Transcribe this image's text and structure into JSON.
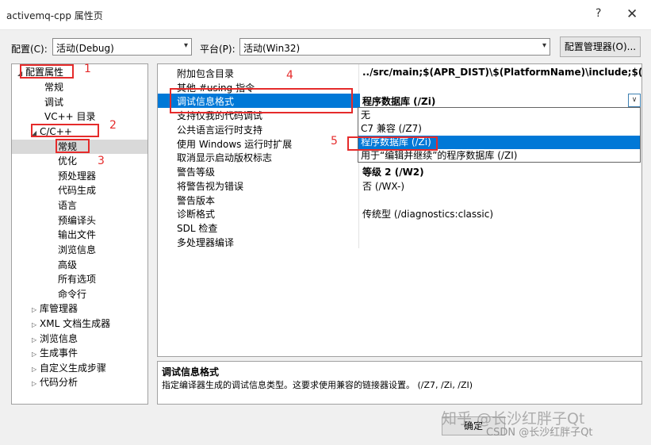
{
  "window": {
    "title": "activemq-cpp 属性页",
    "help_glyph": "?",
    "close_glyph": "✕"
  },
  "config_bar": {
    "config_label": "配置(C):",
    "config_value": "活动(Debug)",
    "platform_label": "平台(P):",
    "platform_value": "活动(Win32)",
    "manager_button": "配置管理器(O)..."
  },
  "tree": {
    "items": [
      {
        "label": "配置属性",
        "expander": "◢"
      },
      {
        "label": "常规",
        "expander": ""
      },
      {
        "label": "调试",
        "expander": ""
      },
      {
        "label": "VC++ 目录",
        "expander": ""
      },
      {
        "label": "C/C++",
        "expander": "◢"
      },
      {
        "label": "常规",
        "expander": ""
      },
      {
        "label": "优化",
        "expander": ""
      },
      {
        "label": "预处理器",
        "expander": ""
      },
      {
        "label": "代码生成",
        "expander": ""
      },
      {
        "label": "语言",
        "expander": ""
      },
      {
        "label": "预编译头",
        "expander": ""
      },
      {
        "label": "输出文件",
        "expander": ""
      },
      {
        "label": "浏览信息",
        "expander": ""
      },
      {
        "label": "高级",
        "expander": ""
      },
      {
        "label": "所有选项",
        "expander": ""
      },
      {
        "label": "命令行",
        "expander": ""
      },
      {
        "label": "库管理器",
        "expander": "▷"
      },
      {
        "label": "XML 文档生成器",
        "expander": "▷"
      },
      {
        "label": "浏览信息",
        "expander": "▷"
      },
      {
        "label": "生成事件",
        "expander": "▷"
      },
      {
        "label": "自定义生成步骤",
        "expander": "▷"
      },
      {
        "label": "代码分析",
        "expander": "▷"
      }
    ]
  },
  "properties": [
    {
      "name": "附加包含目录",
      "value": "../src/main;$(APR_DIST)\\$(PlatformName)\\include;$(OPENSSL"
    },
    {
      "name": "其他 #using 指令",
      "value": ""
    },
    {
      "name": "调试信息格式",
      "value": "程序数据库 (/Zi)"
    },
    {
      "name": "支持仅我的代码调试",
      "value": ""
    },
    {
      "name": "公共语言运行时支持",
      "value": ""
    },
    {
      "name": "使用 Windows 运行时扩展",
      "value": ""
    },
    {
      "name": "取消显示启动版权标志",
      "value": ""
    },
    {
      "name": "警告等级",
      "value": "等级 2 (/W2)"
    },
    {
      "name": "将警告视为错误",
      "value": "否 (/WX-)"
    },
    {
      "name": "警告版本",
      "value": ""
    },
    {
      "name": "诊断格式",
      "value": "传统型 (/diagnostics:classic)"
    },
    {
      "name": "SDL 检查",
      "value": ""
    },
    {
      "name": "多处理器编译",
      "value": ""
    }
  ],
  "dropdown": {
    "options": [
      "无",
      "C7 兼容 (/Z7)",
      "程序数据库 (/Zi)",
      "用于“编辑并继续”的程序数据库 (/ZI)"
    ],
    "selected": "程序数据库 (/Zi)"
  },
  "description": {
    "title": "调试信息格式",
    "text": "指定编译器生成的调试信息类型。这要求使用兼容的链接器设置。  (/Z7, /Zi, /ZI)"
  },
  "buttons": {
    "ok": "确定"
  },
  "annotations": [
    "1",
    "2",
    "3",
    "4",
    "5"
  ],
  "watermarks": {
    "zhihu": "知乎 @长沙红胖子Qt",
    "csdn": "CSDN @长沙红胖子Qt"
  },
  "colors": {
    "selection": "#0078d7",
    "annotation": "#e52b2b",
    "tree_selection": "#d9d9d9"
  }
}
